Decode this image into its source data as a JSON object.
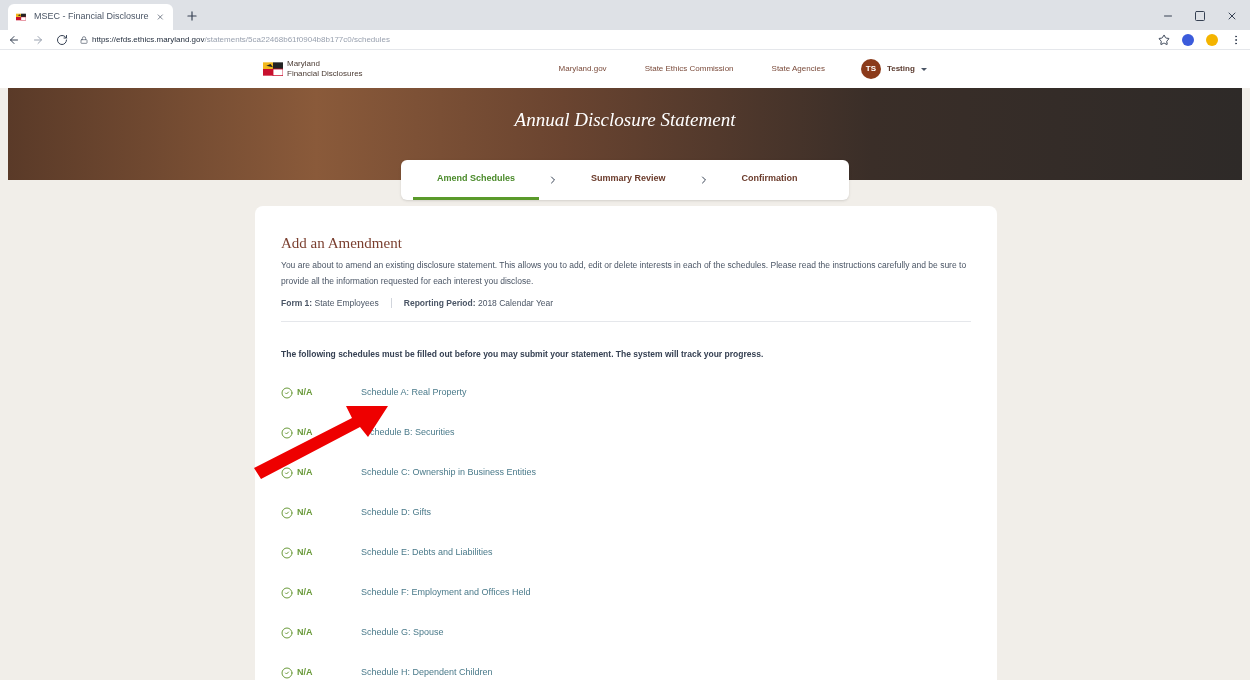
{
  "browser": {
    "tab_title": "MSEC - Financial Disclosure",
    "url_host": "https://efds.ethics.maryland.gov",
    "url_path": "/statements/5ca22468b61f0904b8b177c0/schedules"
  },
  "header": {
    "logo_line1": "Maryland",
    "logo_line2": "Financial Disclosures",
    "nav": [
      "Maryland.gov",
      "State Ethics Commission",
      "State Agencies"
    ],
    "user_initials": "TS",
    "user_name": "Testing"
  },
  "hero_title": "Annual Disclosure Statement",
  "steps": [
    {
      "label": "Amend Schedules",
      "selected": true
    },
    {
      "label": "Summary Review",
      "selected": false
    },
    {
      "label": "Confirmation",
      "selected": false
    }
  ],
  "card": {
    "title": "Add an Amendment",
    "intro": "You are about to amend an existing disclosure statement. This allows you to add, edit or delete interests in each of the schedules. Please read the instructions carefully and be sure to provide all the information requested for each interest you disclose.",
    "form": "**Form 1:** State Employees",
    "period": "**Reporting Period:** 2018 Calendar Year",
    "notice": "The following schedules must be filled out before you may submit your statement. The system will track your progress."
  },
  "schedules": [
    {
      "status": "N/A",
      "label": "Schedule A: Real Property"
    },
    {
      "status": "N/A",
      "label": "chedule B: Securities",
      "kind": "covered"
    },
    {
      "status": "N/A",
      "label": "Schedule C: Ownership in Business Entities"
    },
    {
      "status": "N/A",
      "label": "Schedule D: Gifts"
    },
    {
      "status": "N/A",
      "label": "Schedule E: Debts and Liabilities"
    },
    {
      "status": "N/A",
      "label": "Schedule F: Employment and Offices Held"
    },
    {
      "status": "N/A",
      "label": "Schedule G: Spouse"
    },
    {
      "status": "N/A",
      "label": "Schedule H: Dependent Children"
    }
  ]
}
